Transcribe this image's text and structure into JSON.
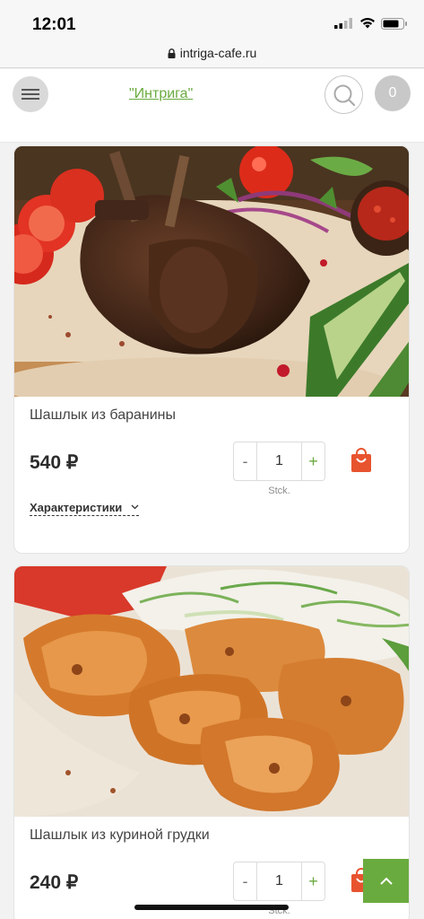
{
  "status_bar": {
    "time": "12:01"
  },
  "browser": {
    "url": "intriga-cafe.ru"
  },
  "header": {
    "brand": "\"Интрига\"",
    "cart_count": "0"
  },
  "products": [
    {
      "name": "Шашлык из баранины",
      "price": "540 ₽",
      "quantity": "1",
      "unit": "Stck.",
      "minus": "-",
      "plus": "+",
      "specs_label": "Характеристики",
      "image": "lamb-chops-photo"
    },
    {
      "name": "Шашлык из куриной грудки",
      "price": "240 ₽",
      "quantity": "1",
      "unit": "Stck.",
      "minus": "-",
      "plus": "+",
      "image": "chicken-breast-kebab-photo"
    }
  ],
  "colors": {
    "accent": "#6aab3f",
    "basket": "#e8532f",
    "cart_badge": "#c8c8c8"
  }
}
